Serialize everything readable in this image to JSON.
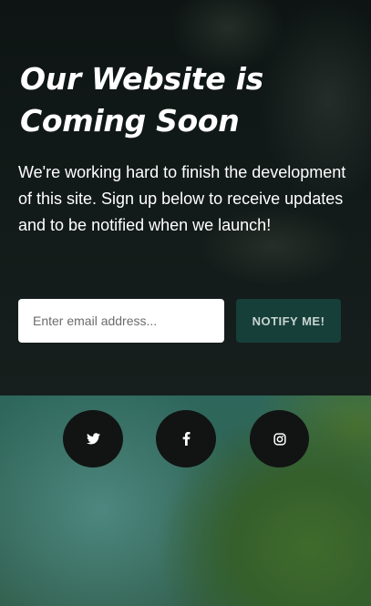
{
  "hero": {
    "title": "Our Website is Coming Soon",
    "description": "We're working hard to finish the development of this site. Sign up below to receive updates and to be notified when we launch!"
  },
  "signup": {
    "email_placeholder": "Enter email address...",
    "email_value": "",
    "button_label": "NOTIFY ME!"
  },
  "social": {
    "items": [
      {
        "name": "twitter",
        "icon": "twitter-icon"
      },
      {
        "name": "facebook",
        "icon": "facebook-icon"
      },
      {
        "name": "instagram",
        "icon": "instagram-icon"
      }
    ]
  },
  "colors": {
    "button_background": "#173f3a",
    "social_background": "#111413",
    "hero_overlay": "#121a19"
  }
}
